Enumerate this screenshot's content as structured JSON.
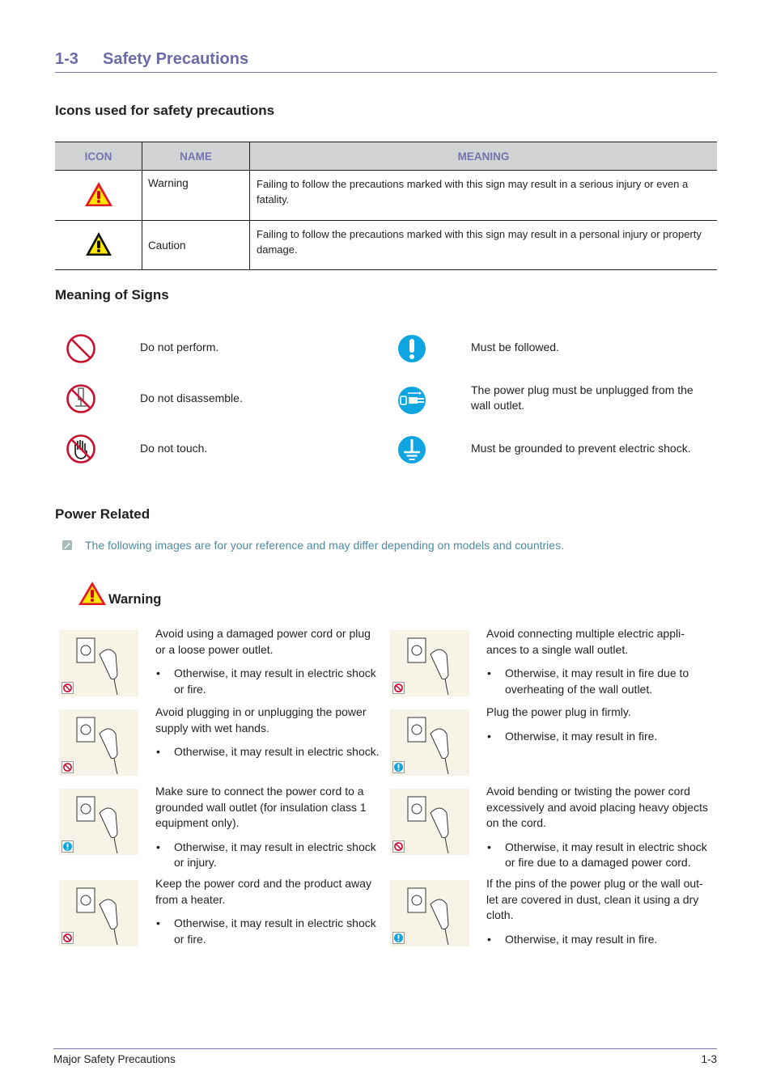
{
  "section": {
    "number": "1-3",
    "title": "Safety Precautions"
  },
  "icons_section": {
    "heading": "Icons used for safety precautions",
    "columns": [
      "ICON",
      "NAME",
      "MEANING"
    ],
    "rows": [
      {
        "icon": "warning-triangle-red-icon",
        "name": "Warning",
        "meaning": "Failing to follow the precautions marked with this sign may result in a serious injury or even a fatality."
      },
      {
        "icon": "caution-triangle-black-icon",
        "name": "Caution",
        "meaning": "Failing to follow the precautions marked with this sign may result in a personal injury or property damage."
      }
    ]
  },
  "signs_section": {
    "heading": "Meaning of Signs",
    "left": [
      {
        "icon": "prohibited-icon",
        "label": "Do not perform."
      },
      {
        "icon": "no-disassemble-icon",
        "label": "Do not disassemble."
      },
      {
        "icon": "no-touch-icon",
        "label": "Do not touch."
      }
    ],
    "right": [
      {
        "icon": "must-follow-icon",
        "label": "Must be followed."
      },
      {
        "icon": "unplug-icon",
        "label": "The power plug must be unplugged from the wall outlet."
      },
      {
        "icon": "ground-icon",
        "label": "Must be grounded to prevent electric shock."
      }
    ]
  },
  "power_section": {
    "heading": "Power Related",
    "note": "The following images are for your reference and may differ depending on models and countries.",
    "warning_label": "Warning",
    "items": [
      {
        "badge": "prohibited",
        "illustration": "damaged-plug-illustration",
        "text": "Avoid using a damaged power cord or plug or a loose power outlet.",
        "bullet": "Otherwise, it may result in electric shock or fire."
      },
      {
        "badge": "prohibited",
        "illustration": "power-strip-illustration",
        "text": "Avoid connecting multiple electric appli-ances to a single wall outlet.",
        "bullet": "Otherwise, it may result in fire due to overheating of the wall outlet."
      },
      {
        "badge": "prohibited",
        "illustration": "wet-hands-illustration",
        "text": "Avoid plugging in or unplugging the power supply with wet hands.",
        "bullet": "Otherwise, it may result in electric shock."
      },
      {
        "badge": "mandatory",
        "illustration": "plug-firmly-illustration",
        "text": "Plug the power plug in firmly.",
        "bullet": "Otherwise, it may result in fire."
      },
      {
        "badge": "mandatory",
        "illustration": "grounded-outlet-illustration",
        "text": "Make sure to connect the power cord to a grounded wall outlet (for insulation class 1 equipment only).",
        "bullet": "Otherwise, it may result in electric shock or injury."
      },
      {
        "badge": "prohibited",
        "illustration": "bent-cord-illustration",
        "text": "Avoid bending or twisting the power cord excessively and avoid placing heavy objects on the cord.",
        "bullet": "Otherwise, it may result in electric shock or fire due to a damaged power cord."
      },
      {
        "badge": "prohibited",
        "illustration": "heater-illustration",
        "text": "Keep the power cord and the product away from a heater.",
        "bullet": "Otherwise, it may result in electric shock or fire."
      },
      {
        "badge": "mandatory",
        "illustration": "dusty-plug-illustration",
        "text": "If the pins of the power plug or the wall out-let are covered in dust, clean it using a dry cloth.",
        "bullet": "Otherwise, it may result in fire."
      }
    ]
  },
  "footer": {
    "left": "Major Safety Precautions",
    "right": "1-3"
  },
  "colors": {
    "heading_accent": "#6b6ba8",
    "note_text": "#4f8ba3",
    "prohibit_red": "#c8102e",
    "mandatory_blue": "#0ea5e0",
    "table_header_bg": "#d1d3d4",
    "illustration_bg": "#f7f4e7"
  }
}
